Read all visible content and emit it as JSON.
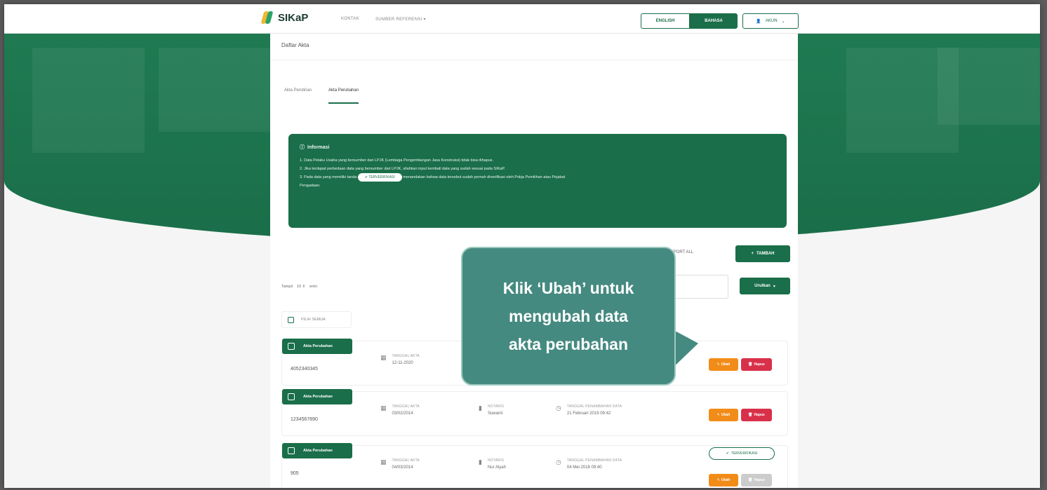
{
  "topbar": {
    "brand": "SIKaP",
    "nav": [
      "KONTAK",
      "SUMBER REFERENSI"
    ],
    "lang_en": "ENGLISH",
    "lang_id": "BAHASA",
    "account": "AKUN"
  },
  "panel": {
    "title": "Daftar Akta",
    "tabs": [
      "Akta Pendirian",
      "Akta Perubahan"
    ]
  },
  "info": {
    "title": "Informasi",
    "lines": [
      "1. Data Pelaku Usaha yang bersumber dari LPJK (Lembaga Pengembangan Jasa Konstruksi) tidak bisa dihapus.",
      "2. Jika terdapat perbedaan data yang bersumber dari LPJK, silahkan input kembali data yang sudah sesuai pada SIKaP.",
      "3. Pada data yang memiliki tanda",
      "menandakan bahwa data tersebut sudah pernah diverifikasi oleh Pokja Pemilihan atau Pejabat",
      "Pengadaan."
    ],
    "pill": "TERVERIFIKASI"
  },
  "toolbar": {
    "export": "EXPORT ALL",
    "tambah": "TAMBAH",
    "tampil": "Tampil",
    "per": "10",
    "entri": "entri",
    "urutkan": "Urutkan",
    "pilih_semua": "PILIH SEMUA"
  },
  "rows": [
    {
      "badge": "Akta Perubahan",
      "number": "4052340345",
      "tgl_label": "TANGGAL AKTA",
      "tgl": "12-11-2020",
      "notaris_label": "",
      "notaris": "",
      "ubah": "Ubah",
      "hapus": "Hapus"
    },
    {
      "badge": "Akta Perubahan",
      "number": "1234567890",
      "tgl_label": "TANGGAL AKTA",
      "tgl": "03/02/2014",
      "notaris_label": "NOTARIS",
      "notaris": "Suwarni",
      "time_label": "TANGGAL PENAMBAHAN DATA",
      "time": "21 Februari 2019 09:42",
      "ubah": "Ubah",
      "hapus": "Hapus"
    },
    {
      "badge": "Akta Perubahan",
      "number": "905",
      "tgl_label": "TANGGAL AKTA",
      "tgl": "04/03/2014",
      "notaris_label": "NOTARIS",
      "notaris": "Nur Alyah",
      "time_label": "TANGGAL PENAMBAHAN DATA",
      "time": "04 Mei 2018 09:40",
      "terverifikasi": "TERVERIFIKASI",
      "ubah": "Ubah",
      "hapus": "Hapus"
    }
  ],
  "callout": {
    "line1": "Klik ‘Ubah’ untuk",
    "line2": "mengubah data",
    "line3": "akta perubahan"
  },
  "colors": {
    "primary": "#1a6e49",
    "ubah": "#f28c18",
    "hapus": "#d9304a",
    "callout": "#458a80"
  }
}
